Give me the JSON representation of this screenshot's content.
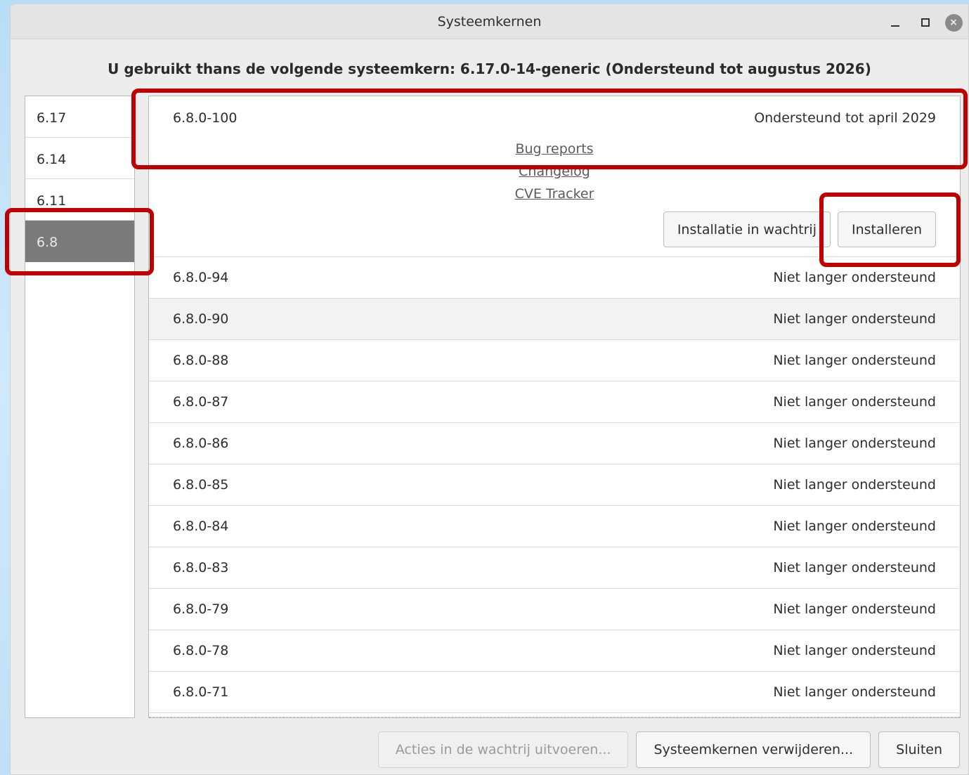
{
  "window": {
    "title": "Systeemkernen",
    "controls": {
      "minimize": "–",
      "maximize": "□",
      "close": "×"
    }
  },
  "current_kernel_text": "U gebruikt thans de volgende systeemkern: 6.17.0-14-generic (Ondersteund tot augustus 2026)",
  "series": [
    {
      "label": "6.17",
      "selected": false
    },
    {
      "label": "6.14",
      "selected": false
    },
    {
      "label": "6.11",
      "selected": false
    },
    {
      "label": "6.8",
      "selected": true
    }
  ],
  "expanded_kernel": {
    "version": "6.8.0-100",
    "status": "Ondersteund tot april 2029",
    "links": [
      "Bug reports",
      "Changelog",
      "CVE Tracker"
    ],
    "queue_button": "Installatie in wachtrij",
    "install_button": "Installeren"
  },
  "kernels": [
    {
      "version": "6.8.0-94",
      "status": "Niet langer ondersteund"
    },
    {
      "version": "6.8.0-90",
      "status": "Niet langer ondersteund"
    },
    {
      "version": "6.8.0-88",
      "status": "Niet langer ondersteund"
    },
    {
      "version": "6.8.0-87",
      "status": "Niet langer ondersteund"
    },
    {
      "version": "6.8.0-86",
      "status": "Niet langer ondersteund"
    },
    {
      "version": "6.8.0-85",
      "status": "Niet langer ondersteund"
    },
    {
      "version": "6.8.0-84",
      "status": "Niet langer ondersteund"
    },
    {
      "version": "6.8.0-83",
      "status": "Niet langer ondersteund"
    },
    {
      "version": "6.8.0-79",
      "status": "Niet langer ondersteund"
    },
    {
      "version": "6.8.0-78",
      "status": "Niet langer ondersteund"
    },
    {
      "version": "6.8.0-71",
      "status": "Niet langer ondersteund"
    }
  ],
  "footer": {
    "run_queue": "Acties in de wachtrij uitvoeren...",
    "remove": "Systeemkernen verwijderen...",
    "close": "Sluiten"
  },
  "colors": {
    "highlight": "#c00000",
    "selected_series": "#7a7a7a"
  }
}
